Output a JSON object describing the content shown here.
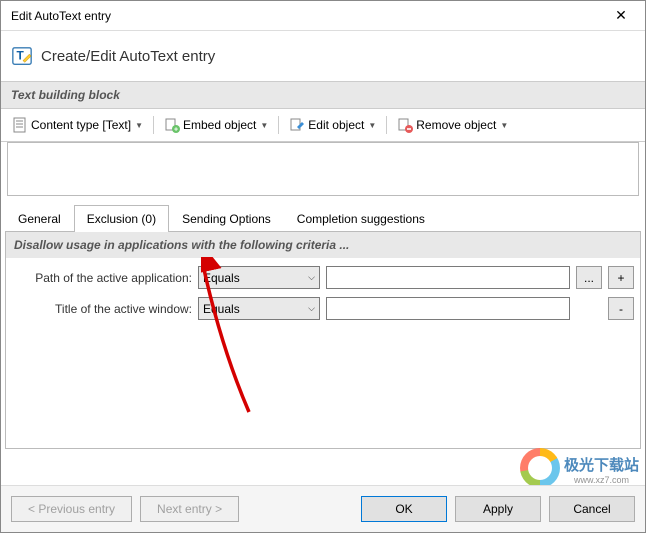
{
  "titlebar": {
    "title": "Edit AutoText entry"
  },
  "header": {
    "title": "Create/Edit AutoText entry"
  },
  "section1": {
    "label": "Text building block"
  },
  "toolbar": {
    "content_type": "Content type [Text]",
    "embed": "Embed object",
    "edit": "Edit object",
    "remove": "Remove object"
  },
  "tabs": {
    "general": "General",
    "exclusion": "Exclusion (0)",
    "sending": "Sending Options",
    "completion": "Completion suggestions"
  },
  "panel": {
    "criteria_label": "Disallow usage in applications with the following criteria ...",
    "rows": [
      {
        "label": "Path of the active application:",
        "op": "Equals",
        "value": "",
        "browse": "...",
        "action": "+"
      },
      {
        "label": "Title of the active window:",
        "op": "Equals",
        "value": "",
        "browse": null,
        "action": "-"
      }
    ]
  },
  "footer": {
    "prev": "< Previous entry",
    "next": "Next entry >",
    "ok": "OK",
    "apply": "Apply",
    "cancel": "Cancel"
  },
  "watermark": {
    "title": "极光下载站",
    "url": "www.xz7.com"
  }
}
